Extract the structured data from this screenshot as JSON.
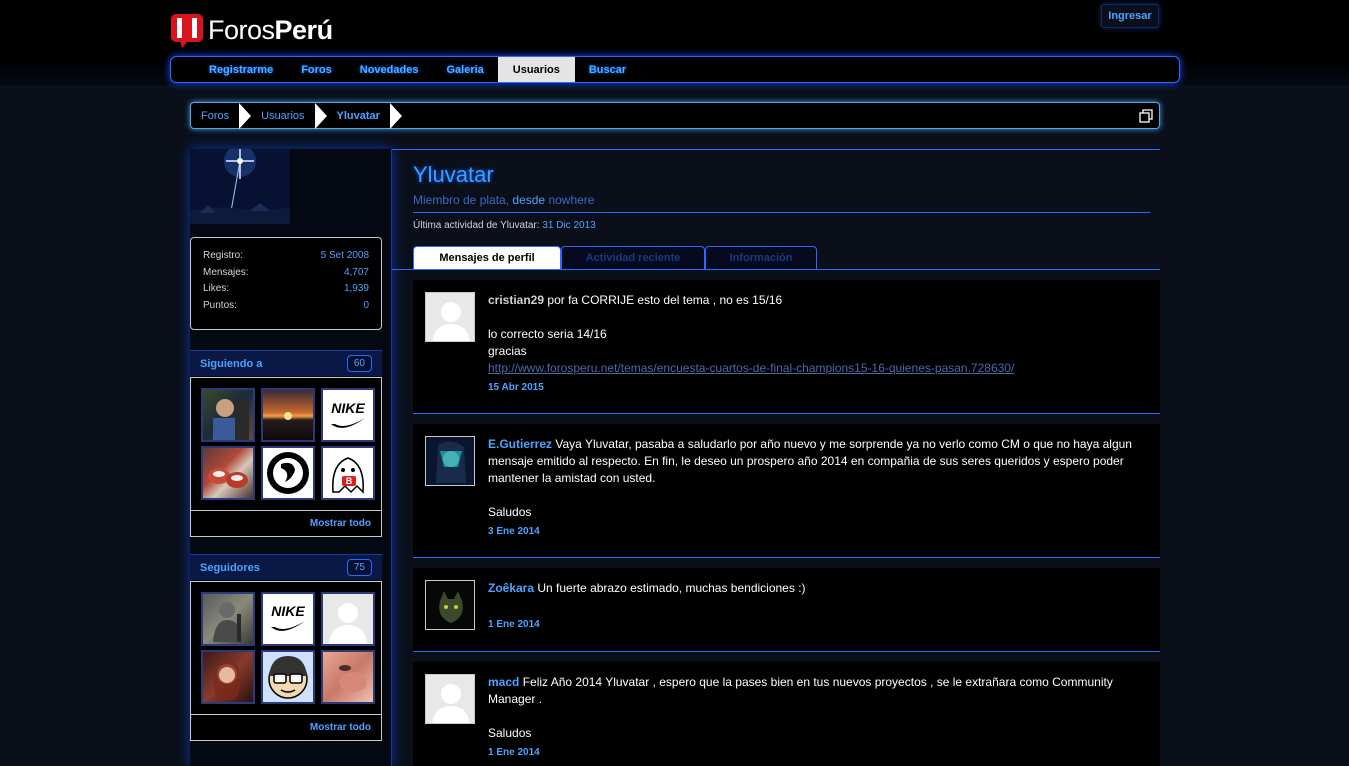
{
  "header": {
    "logo_text_a": "Foros",
    "logo_text_b": "Perú",
    "login_label": "Ingresar"
  },
  "nav": {
    "items": [
      {
        "label": "Registrarme"
      },
      {
        "label": "Foros"
      },
      {
        "label": "Novedades"
      },
      {
        "label": "Galeria"
      },
      {
        "label": "Usuarios"
      },
      {
        "label": "Buscar"
      }
    ],
    "active": "Usuarios"
  },
  "breadcrumb": {
    "items": [
      {
        "label": "Foros"
      },
      {
        "label": "Usuarios"
      },
      {
        "label": "Yluvatar"
      }
    ]
  },
  "sidebar": {
    "stats": [
      {
        "label": "Registro:",
        "value": "5 Set 2008"
      },
      {
        "label": "Mensajes:",
        "value": "4,707"
      },
      {
        "label": "Likes:",
        "value": "1,939"
      },
      {
        "label": "Puntos:",
        "value": "0"
      }
    ],
    "following": {
      "title": "Siguiendo a",
      "count": "60",
      "show_all": "Mostrar todo"
    },
    "followers": {
      "title": "Seguidores",
      "count": "75",
      "show_all": "Mostrar todo"
    }
  },
  "profile": {
    "name": "Yluvatar",
    "rank": "Miembro de plata,",
    "desde": "desde",
    "location": "nowhere",
    "last_activity_label": "Última actividad de Yluvatar:",
    "last_activity_date": "31 Dic 2013"
  },
  "tabs": [
    {
      "label": "Mensajes de perfil"
    },
    {
      "label": "Actividad reciente"
    },
    {
      "label": "Información"
    }
  ],
  "posts": [
    {
      "author": "cristian29",
      "text1": "por fa CORRIJE esto del tema , no es 15/16",
      "text2": "lo correcto seria 14/16",
      "text3": "gracias",
      "link": "http://www.forosperu.net/temas/encuesta-cuartos-de-final-champions15-16-quienes-pasan.728630/",
      "date": "15 Abr 2015"
    },
    {
      "author": "E.Gutierrez",
      "text1": "Vaya Yluvatar, pasaba a saludarlo por año nuevo y me sorprende ya no verlo como CM o que no haya algun mensaje emitido al respecto. En fin, le deseo un prospero año 2014 en compañia de sus seres queridos y espero poder mantener la amistad con usted.",
      "text2": "Saludos",
      "date": "3 Ene 2014"
    },
    {
      "author": "Zoêkara",
      "text1": "Un fuerte abrazo estimado, muchas bendiciones :)",
      "date": "1 Ene 2014"
    },
    {
      "author": "macd",
      "text1": "Feliz Año 2014 Yluvatar , espero que la pases bien en tus nuevos proyectos , se le extrañara como Community Manager .",
      "text2": "Saludos",
      "date": "1 Ene 2014"
    }
  ]
}
